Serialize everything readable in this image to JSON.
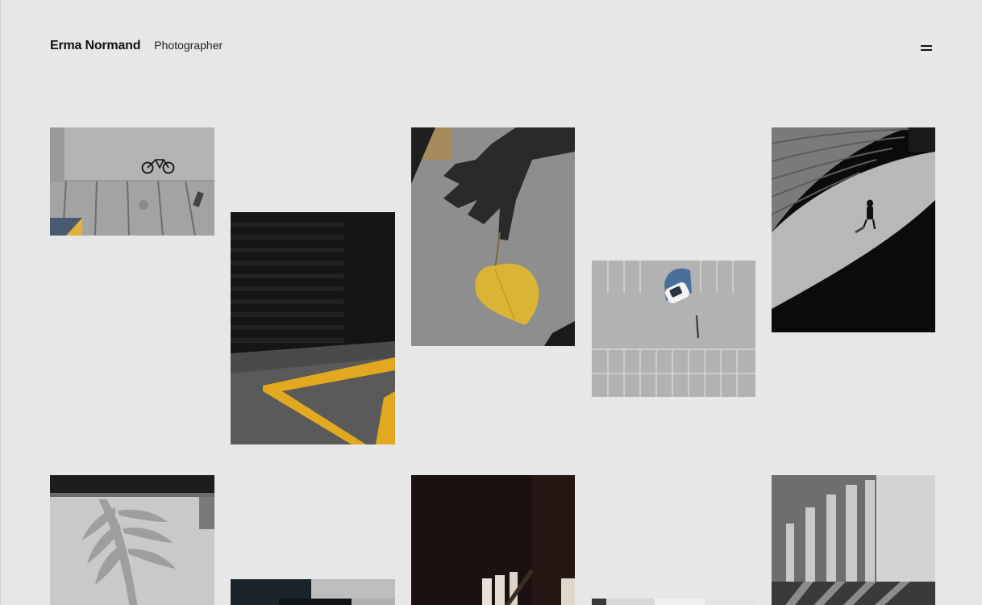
{
  "header": {
    "name": "Erma Normand",
    "role": "Photographer"
  },
  "menu": {
    "icon": "menu-icon"
  },
  "gallery": {
    "photos": [
      {
        "subject": "bicycle-on-pavement"
      },
      {
        "subject": "garage-yellow-lines"
      },
      {
        "subject": "hand-shadow-yellow-leaf"
      },
      {
        "subject": "aerial-white-car"
      },
      {
        "subject": "person-walking-curved-ramp"
      },
      {
        "subject": "palm-leaf-shadow-wall"
      },
      {
        "subject": "dark-building-corner"
      },
      {
        "subject": "window-light-dark-room"
      },
      {
        "subject": "white-building-edge"
      },
      {
        "subject": "column-shadows-concrete"
      }
    ]
  }
}
